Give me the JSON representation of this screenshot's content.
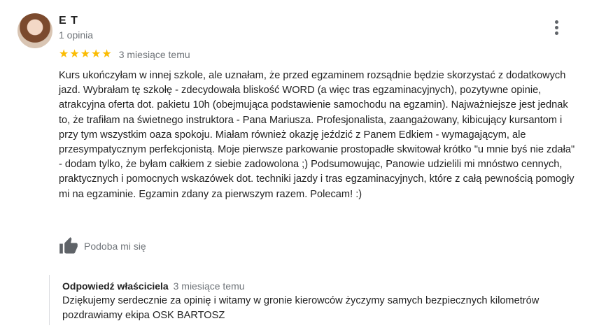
{
  "review": {
    "reviewer_name": "E T",
    "review_count": "1 opinia",
    "rating": 5,
    "stars": [
      "★",
      "★",
      "★",
      "★",
      "★"
    ],
    "date": "3 miesiące temu",
    "text": "Kurs ukończyłam w innej szkole, ale uznałam, że przed egzaminem rozsądnie będzie skorzystać z dodatkowych jazd. Wybrałam tę szkołę - zdecydowała bliskość WORD (a więc tras egzaminacyjnych), pozytywne opinie, atrakcyjna oferta dot. pakietu 10h (obejmująca podstawienie samochodu na egzamin). Najważniejsze jest jednak to, że trafiłam na świetnego instruktora - Pana Mariusza. Profesjonalista, zaangażowany, kibicujący kursantom i przy tym wszystkim oaza spokoju. Miałam również okazję jeździć z Panem Edkiem - wymagającym, ale przesympatycznym perfekcjonistą. Moje pierwsze parkowanie prostopadłe skwitował krótko \"u mnie byś nie zdała\" - dodam tylko, że byłam całkiem z siebie zadowolona ;) Podsumowując, Panowie udzielili mi mnóstwo cennych, praktycznych i pomocnych wskazówek dot. techniki jazdy i tras egzaminacyjnych, które z całą pewnością pomogły mi na egzaminie. Egzamin zdany za pierwszym razem. Polecam! :)",
    "like_label": "Podoba mi się"
  },
  "owner_reply": {
    "title": "Odpowiedź właściciela",
    "date": "3 miesiące temu",
    "text": "Dziękujemy serdecznie za opinię i witamy w gronie kierowców życzymy samych bezpiecznych kilometrów pozdrawiamy ekipa OSK BARTOSZ"
  },
  "colors": {
    "star": "#fbbc04",
    "secondary_text": "#70757a",
    "primary_text": "#222222",
    "icon": "#5f6368"
  },
  "icons": {
    "more": "more-vert-icon",
    "like": "thumbs-up-icon",
    "avatar": "user-avatar"
  }
}
